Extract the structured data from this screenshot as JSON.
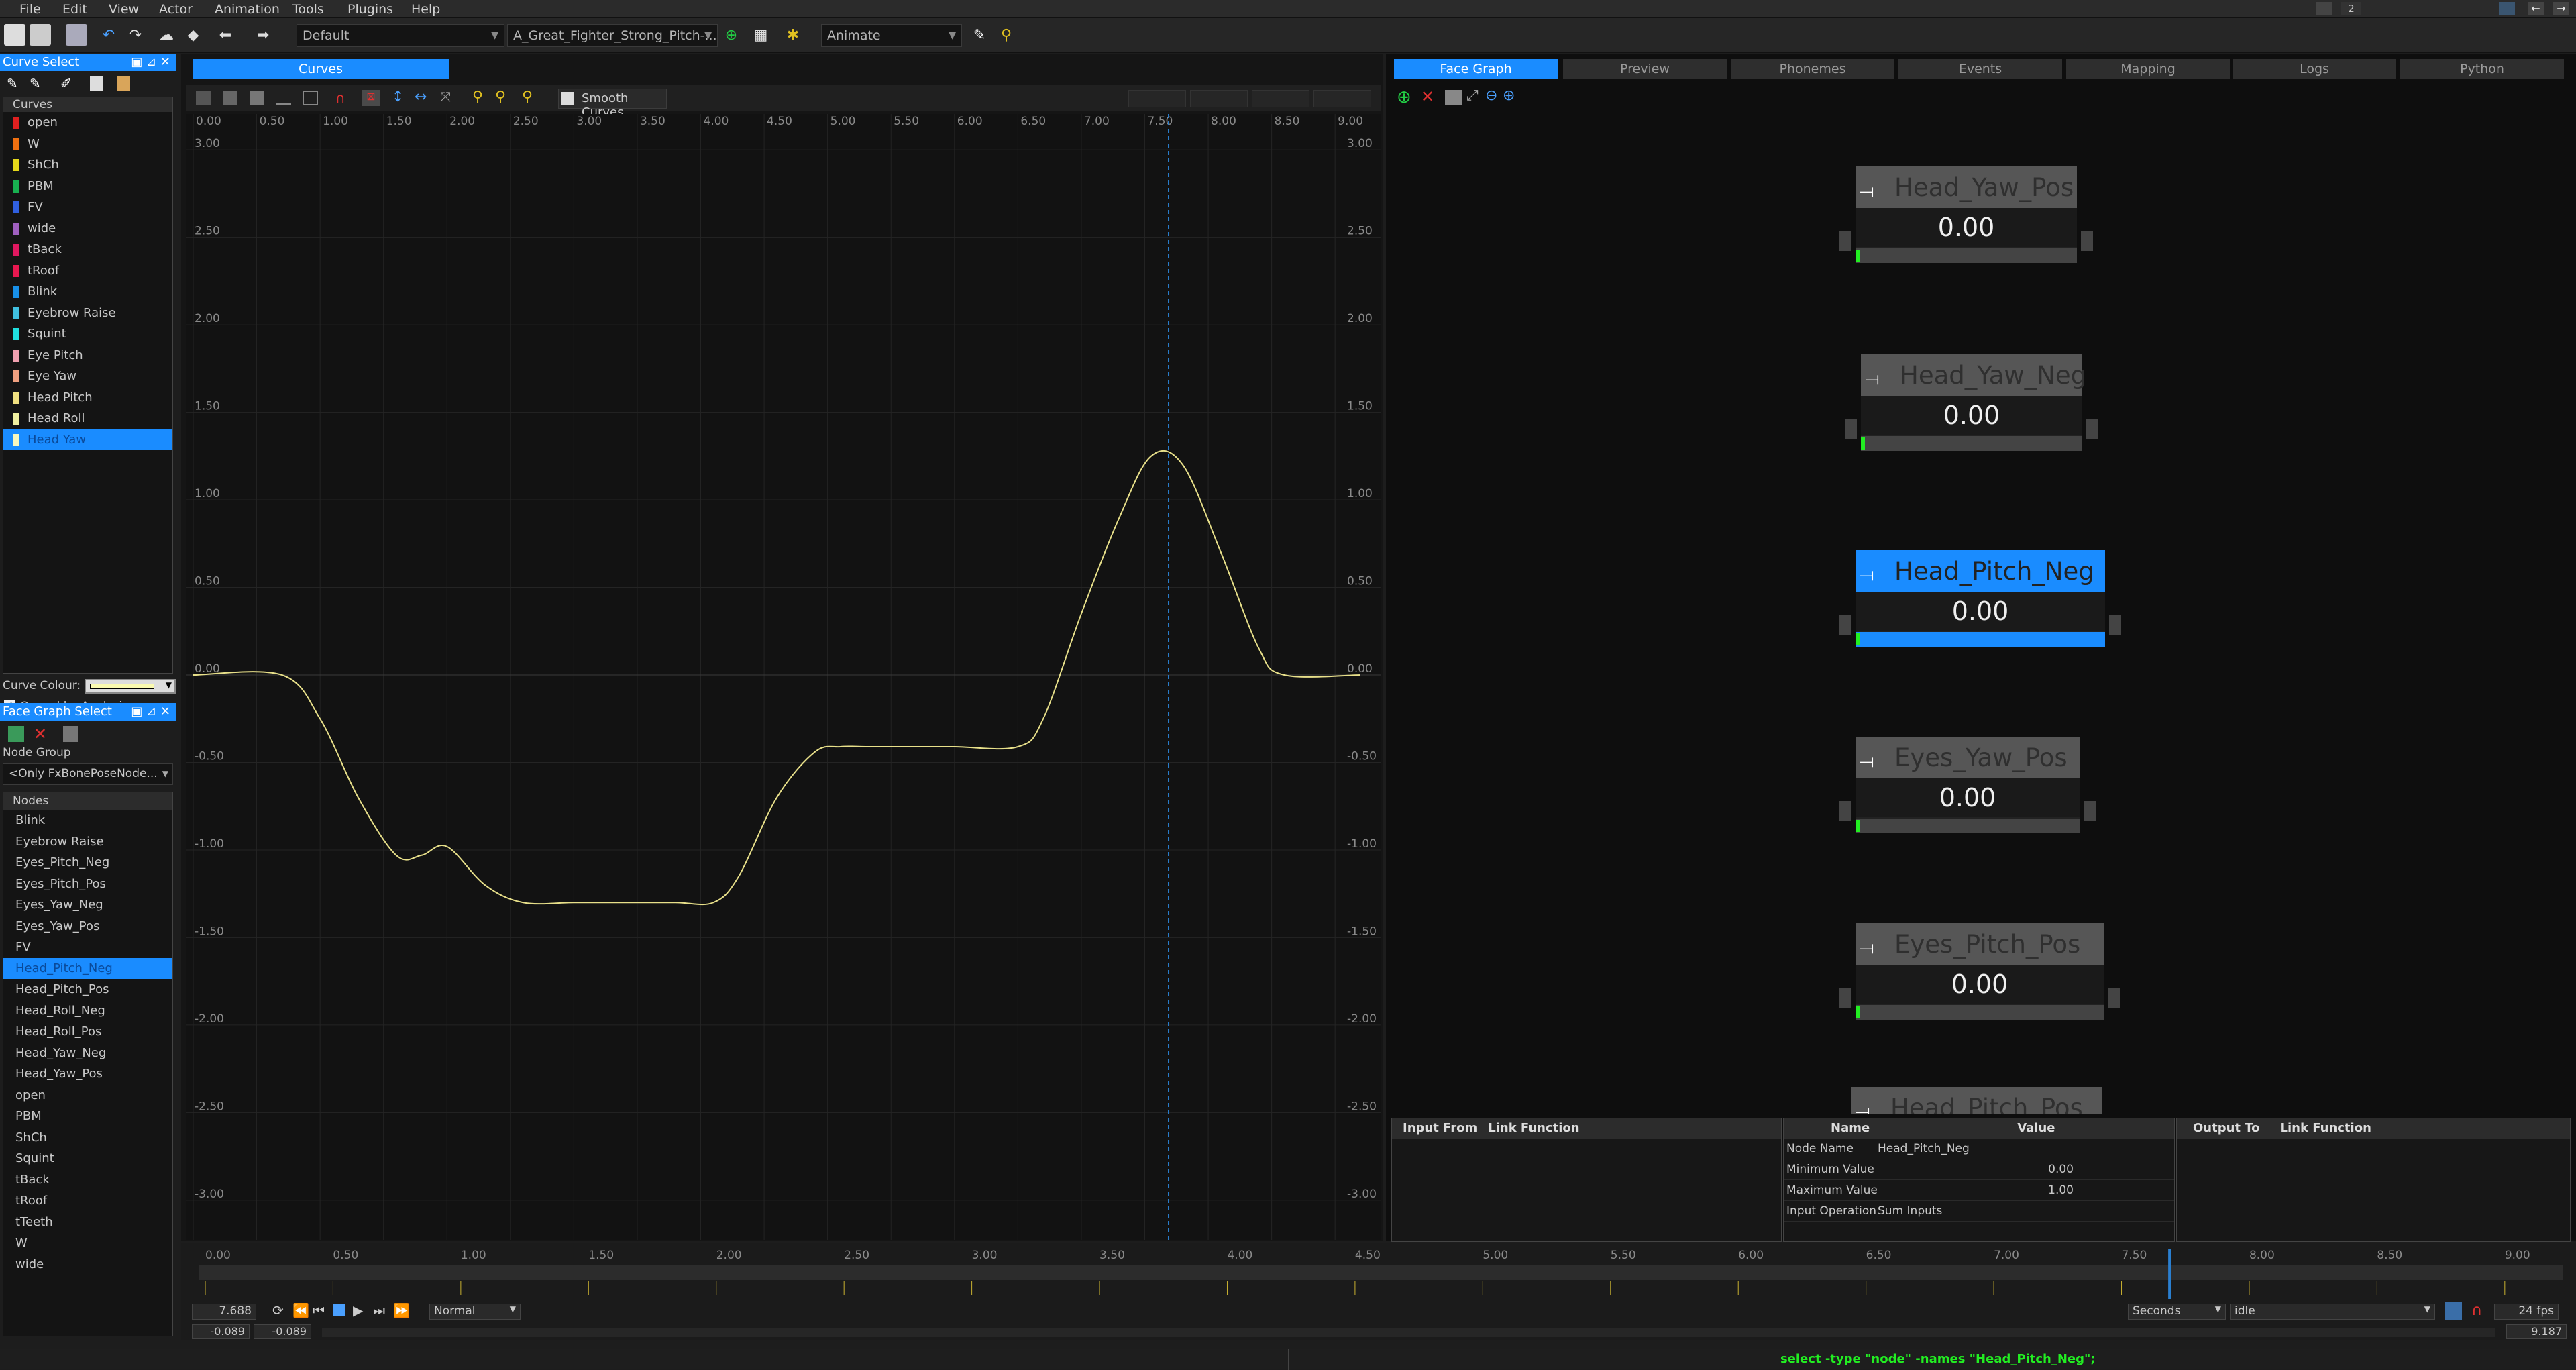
{
  "menu": [
    "File",
    "Edit",
    "View",
    "Actor",
    "Animation",
    "Tools",
    "Plugins",
    "Help"
  ],
  "toolbar": {
    "layout_combo": "Default",
    "animation_combo": "A_Great_Fighter_Strong_Pitch-...",
    "mode_combo": "Animate",
    "top_right_count": "2"
  },
  "curve_select": {
    "title": "Curve Select",
    "curves_header": "Curves",
    "items": [
      {
        "label": "open",
        "color": "#e02020"
      },
      {
        "label": "W",
        "color": "#f07010"
      },
      {
        "label": "ShCh",
        "color": "#e6d81a"
      },
      {
        "label": "PBM",
        "color": "#18b050"
      },
      {
        "label": "FV",
        "color": "#3060e0"
      },
      {
        "label": "wide",
        "color": "#a060c0"
      },
      {
        "label": "tBack",
        "color": "#e01860"
      },
      {
        "label": "tRoof",
        "color": "#e81850"
      },
      {
        "label": "Blink",
        "color": "#1890e8"
      },
      {
        "label": "Eyebrow Raise",
        "color": "#40c0e0"
      },
      {
        "label": "Squint",
        "color": "#20e0e0"
      },
      {
        "label": "Eye Pitch",
        "color": "#f0a0b0"
      },
      {
        "label": "Eye Yaw",
        "color": "#f0a080"
      },
      {
        "label": "Head Pitch",
        "color": "#f0e080"
      },
      {
        "label": "Head Roll",
        "color": "#f0f0a0"
      },
      {
        "label": "Head Yaw",
        "color": "#f8f8c0"
      }
    ],
    "curve_colour_label": "Curve Colour:",
    "owned_by_analysis": "Owned by Analysis"
  },
  "face_graph_select": {
    "title": "Face Graph Select",
    "node_group_label": "Node Group",
    "node_group_value": "<Only FxBonePoseNode...",
    "nodes_header": "Nodes",
    "nodes": [
      "Blink",
      "Eyebrow Raise",
      "Eyes_Pitch_Neg",
      "Eyes_Pitch_Pos",
      "Eyes_Yaw_Neg",
      "Eyes_Yaw_Pos",
      "FV",
      "Head_Pitch_Neg",
      "Head_Pitch_Pos",
      "Head_Roll_Neg",
      "Head_Roll_Pos",
      "Head_Yaw_Neg",
      "Head_Yaw_Pos",
      "open",
      "PBM",
      "ShCh",
      "Squint",
      "tBack",
      "tRoof",
      "tTeeth",
      "W",
      "wide"
    ],
    "selected_node": "Head_Pitch_Neg"
  },
  "curve_editor": {
    "tab": "Curves",
    "smooth_curves": "Smooth Curves",
    "x_ticks": [
      "0.00",
      "0.50",
      "1.00",
      "1.50",
      "2.00",
      "2.50",
      "3.00",
      "3.50",
      "4.00",
      "4.50",
      "5.00",
      "5.50",
      "6.00",
      "6.50",
      "7.00",
      "7.50",
      "8.00",
      "8.50",
      "9.00"
    ],
    "y_ticks": [
      "3.00",
      "2.50",
      "2.00",
      "1.50",
      "1.00",
      "0.50",
      "0.00",
      "-0.50",
      "-1.00",
      "-1.50",
      "-2.00",
      "-2.50",
      "-3.00"
    ]
  },
  "chart_data": {
    "type": "line",
    "xlim": [
      0,
      9.2
    ],
    "ylim": [
      -3.15,
      3.15
    ],
    "grid": true,
    "cursor_x": 7.688,
    "series": [
      {
        "color": "#e8e08a",
        "x": [
          0,
          0.7,
          1.0,
          1.3,
          1.6,
          1.8,
          2.0,
          2.3,
          2.6,
          3.0,
          3.4,
          3.8,
          4.1,
          4.3,
          4.6,
          4.9,
          5.1,
          5.3,
          5.6,
          6.0,
          6.5,
          6.7,
          7.0,
          7.3,
          7.55,
          7.8,
          8.1,
          8.4,
          8.6,
          9.2
        ],
        "y": [
          0,
          0,
          -0.25,
          -0.7,
          -1.03,
          -1.03,
          -0.98,
          -1.2,
          -1.3,
          -1.3,
          -1.3,
          -1.3,
          -1.3,
          -1.15,
          -0.7,
          -0.44,
          -0.41,
          -0.41,
          -0.41,
          -0.41,
          -0.41,
          -0.25,
          0.35,
          0.9,
          1.25,
          1.2,
          0.7,
          0.15,
          0,
          0
        ]
      }
    ]
  },
  "face_graph": {
    "tabs": [
      "Face Graph",
      "Preview",
      "Phonemes",
      "Events",
      "Mapping",
      "Logs",
      "Python"
    ],
    "nodes": [
      {
        "name": "Head_Yaw_Pos",
        "value": "0.00"
      },
      {
        "name": "Head_Yaw_Neg",
        "value": "0.00"
      },
      {
        "name": "Head_Pitch_Neg",
        "value": "0.00"
      },
      {
        "name": "Eyes_Yaw_Pos",
        "value": "0.00"
      },
      {
        "name": "Eyes_Pitch_Pos",
        "value": "0.00"
      },
      {
        "name": "Head_Pitch_Pos",
        "value": ""
      }
    ]
  },
  "link_panels": {
    "input": {
      "col1": "Input From",
      "col2": "Link Function"
    },
    "output": {
      "col1": "Output To",
      "col2": "Link Function"
    },
    "props": {
      "col1": "Name",
      "col2": "Value",
      "rows": [
        {
          "k": "Node Name",
          "v": "Head_Pitch_Neg"
        },
        {
          "k": "Minimum Value",
          "v": "0.00"
        },
        {
          "k": "Maximum Value",
          "v": "1.00"
        },
        {
          "k": "Input Operation",
          "v": "Sum Inputs"
        }
      ]
    }
  },
  "timeline": {
    "ticks": [
      "0.00",
      "0.50",
      "1.00",
      "1.50",
      "2.00",
      "2.50",
      "3.00",
      "3.50",
      "4.00",
      "4.50",
      "5.00",
      "5.50",
      "6.00",
      "6.50",
      "7.00",
      "7.50",
      "8.00",
      "8.50",
      "9.00"
    ],
    "current_time": "7.688",
    "val_a": "-0.089",
    "val_b": "-0.089",
    "speed": "Normal",
    "units": "Seconds",
    "anim_state": "idle",
    "fps": "24 fps",
    "end_a": "9.187",
    "end_b": "9.187"
  },
  "status": "select -type \"node\" -names \"Head_Pitch_Neg\";"
}
